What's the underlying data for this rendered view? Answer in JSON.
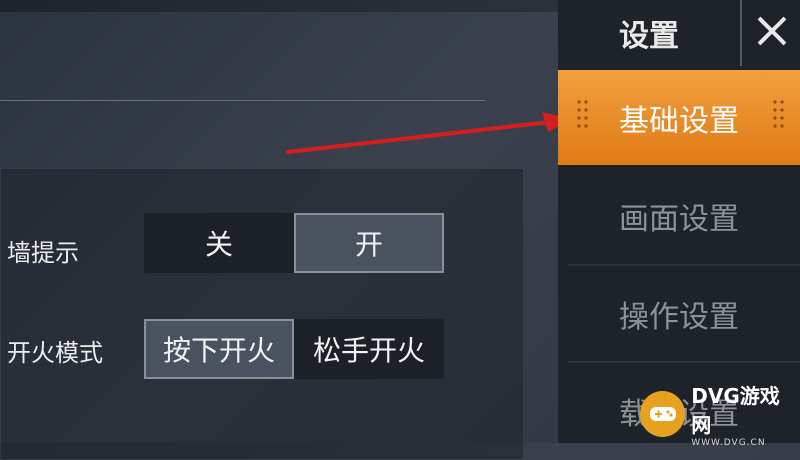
{
  "sidebar": {
    "title": "设置",
    "items": [
      {
        "label": "基础设置",
        "active": true
      },
      {
        "label": "画面设置",
        "active": false
      },
      {
        "label": "操作设置",
        "active": false
      },
      {
        "label": "载具设置",
        "active": false
      }
    ]
  },
  "settings": {
    "wall_hint": {
      "label": "墙提示",
      "options": [
        "关",
        "开"
      ],
      "selected": "开"
    },
    "fire_mode": {
      "label": "开火模式",
      "options": [
        "按下开火",
        "松手开火"
      ],
      "selected": "按下开火"
    }
  },
  "watermark": {
    "title": "DVG游戏网",
    "sub": "WWW.DVG.CN"
  },
  "colors": {
    "accent": "#e58a22",
    "arrow": "#d51f1f"
  }
}
